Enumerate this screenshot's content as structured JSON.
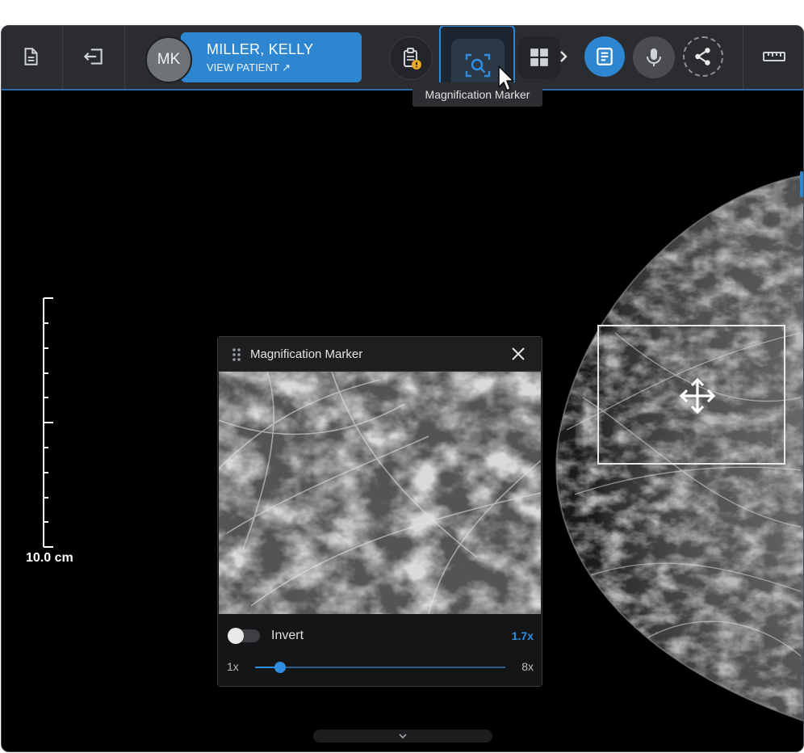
{
  "patient": {
    "initials": "MK",
    "name": "MILLER, KELLY",
    "view_label": "VIEW PATIENT ↗"
  },
  "toolbar": {
    "tooltip": "Magnification Marker",
    "accent": "#2f86d0"
  },
  "scale_bar": {
    "label": "10.0 cm"
  },
  "magnifier": {
    "title": "Magnification Marker",
    "invert_label": "Invert",
    "invert_on": false,
    "zoom_label": "1.7x",
    "zoom_value": 1.7,
    "min_label": "1x",
    "max_label": "8x",
    "min": 1,
    "max": 8
  },
  "icons": [
    "document-icon",
    "exit-icon",
    "clipboard-alert-icon",
    "magnify-scan-icon",
    "grid-layout-icon",
    "chevron-right-icon",
    "report-icon",
    "microphone-icon",
    "share-icon",
    "ruler-icon",
    "close-icon",
    "drag-handle-icon",
    "move-icon",
    "chevron-down-icon",
    "cursor-icon"
  ]
}
